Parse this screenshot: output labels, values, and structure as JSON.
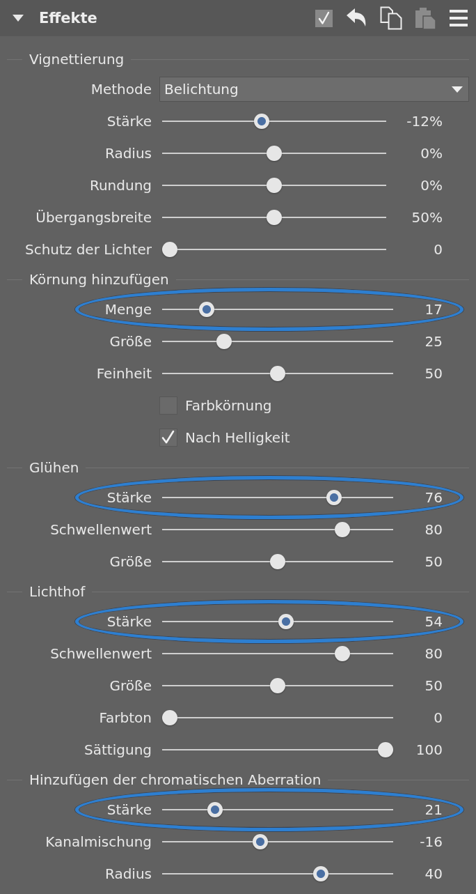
{
  "header": {
    "title": "Effekte",
    "expanded": true,
    "enabled": true,
    "tools": [
      {
        "kind": "undo",
        "disabled": false
      },
      {
        "kind": "copy",
        "disabled": false
      },
      {
        "kind": "paste",
        "disabled": true
      },
      {
        "kind": "menu",
        "disabled": false
      }
    ]
  },
  "groups": [
    {
      "title": "Vignettierung",
      "rows": [
        {
          "kind": "dropdown",
          "label": "Methode",
          "value": "Belichtung"
        },
        {
          "kind": "slider",
          "label": "Stärke",
          "level": 0.44,
          "value": "-12%",
          "modified": true,
          "highlighted": false
        },
        {
          "kind": "slider",
          "label": "Radius",
          "level": 0.5,
          "value": "0%",
          "modified": false,
          "highlighted": false
        },
        {
          "kind": "slider",
          "label": "Rundung",
          "level": 0.5,
          "value": "0%",
          "modified": false,
          "highlighted": false
        },
        {
          "kind": "slider",
          "label": "Übergangsbreite",
          "level": 0.5,
          "value": "50%",
          "modified": false,
          "highlighted": false
        },
        {
          "kind": "slider",
          "label": "Schutz der Lichter",
          "level": 0,
          "value": "0",
          "modified": false,
          "highlighted": false
        }
      ]
    },
    {
      "title": "Körnung hinzufügen",
      "rows": [
        {
          "kind": "slider",
          "label": "Menge",
          "level": 0.17,
          "value": "17",
          "modified": true,
          "highlighted": true
        },
        {
          "kind": "slider",
          "label": "Größe",
          "level": 0.25,
          "value": "25",
          "modified": false,
          "highlighted": false
        },
        {
          "kind": "slider",
          "label": "Feinheit",
          "level": 0.5,
          "value": "50",
          "modified": false,
          "highlighted": false
        },
        {
          "kind": "checkbox",
          "label": "Farbkörnung",
          "checked": false
        },
        {
          "kind": "checkbox",
          "label": "Nach Helligkeit",
          "checked": true
        }
      ]
    },
    {
      "title": "Glühen",
      "rows": [
        {
          "kind": "slider",
          "label": "Stärke",
          "level": 0.76,
          "value": "76",
          "modified": true,
          "highlighted": true
        },
        {
          "kind": "slider",
          "label": "Schwellenwert",
          "level": 0.8,
          "value": "80",
          "modified": false,
          "highlighted": false
        },
        {
          "kind": "slider",
          "label": "Größe",
          "level": 0.5,
          "value": "50",
          "modified": false,
          "highlighted": false
        }
      ]
    },
    {
      "title": "Lichthof",
      "rows": [
        {
          "kind": "slider",
          "label": "Stärke",
          "level": 0.54,
          "value": "54",
          "modified": true,
          "highlighted": true
        },
        {
          "kind": "slider",
          "label": "Schwellenwert",
          "level": 0.8,
          "value": "80",
          "modified": false,
          "highlighted": false
        },
        {
          "kind": "slider",
          "label": "Größe",
          "level": 0.5,
          "value": "50",
          "modified": false,
          "highlighted": false
        },
        {
          "kind": "slider",
          "label": "Farbton",
          "level": 0,
          "value": "0",
          "modified": false,
          "highlighted": false
        },
        {
          "kind": "slider",
          "label": "Sättigung",
          "level": 1,
          "value": "100",
          "modified": false,
          "highlighted": false
        }
      ]
    },
    {
      "title": "Hinzufügen der chromatischen Aberration",
      "rows": [
        {
          "kind": "slider",
          "label": "Stärke",
          "level": 0.21,
          "value": "21",
          "modified": true,
          "highlighted": true
        },
        {
          "kind": "slider",
          "label": "Kanalmischung",
          "level": 0.42,
          "value": "-16",
          "modified": true,
          "highlighted": false
        },
        {
          "kind": "slider",
          "label": "Radius",
          "level": 0.7,
          "value": "40",
          "modified": true,
          "highlighted": false
        }
      ]
    }
  ]
}
